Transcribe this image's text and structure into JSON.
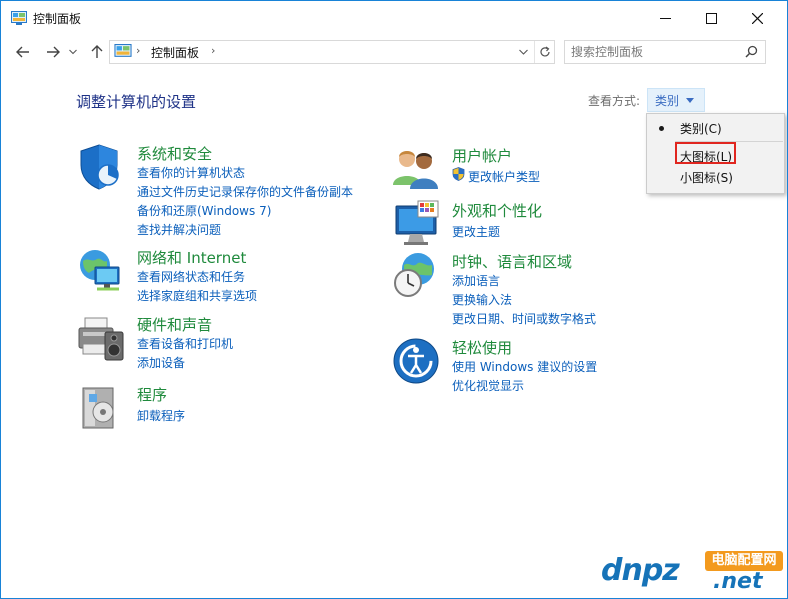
{
  "window": {
    "title": "控制面板"
  },
  "navbar": {
    "address_path": "控制面板",
    "search_placeholder": "搜索控制面板"
  },
  "main": {
    "heading": "调整计算机的设置",
    "view_by_label": "查看方式:",
    "view_by_value": "类别",
    "categories": [
      {
        "title": "系统和安全",
        "links": [
          "查看你的计算机状态",
          "通过文件历史记录保存你的文件备份副本",
          "备份和还原(Windows 7)",
          "查找并解决问题"
        ]
      },
      {
        "title": "网络和 Internet",
        "links": [
          "查看网络状态和任务",
          "选择家庭组和共享选项"
        ]
      },
      {
        "title": "硬件和声音",
        "links": [
          "查看设备和打印机",
          "添加设备"
        ]
      },
      {
        "title": "程序",
        "links": [
          "卸载程序"
        ]
      },
      {
        "title": "用户帐户",
        "links": [
          "更改帐户类型"
        ]
      },
      {
        "title": "外观和个性化",
        "links": [
          "更改主题"
        ]
      },
      {
        "title": "时钟、语言和区域",
        "links": [
          "添加语言",
          "更换输入法",
          "更改日期、时间或数字格式"
        ]
      },
      {
        "title": "轻松使用",
        "links": [
          "使用 Windows 建议的设置",
          "优化视觉显示"
        ]
      }
    ]
  },
  "view_menu": {
    "items": [
      {
        "label": "类别(C)",
        "selected": true
      },
      {
        "label": "大图标(L)",
        "selected": false,
        "highlighted": true
      },
      {
        "label": "小图标(S)",
        "selected": false
      }
    ]
  },
  "watermark": {
    "logo_text": "dnpz",
    "badge": "电脑配置网",
    "domain": ".net"
  },
  "colors": {
    "window_border": "#1883d7",
    "category_title": "#1f8a3c",
    "link": "#0b5fbb",
    "heading": "#1e3287",
    "highlight_box": "#e0261f",
    "watermark_blue": "#1673b8",
    "watermark_orange": "#f39a1e"
  }
}
